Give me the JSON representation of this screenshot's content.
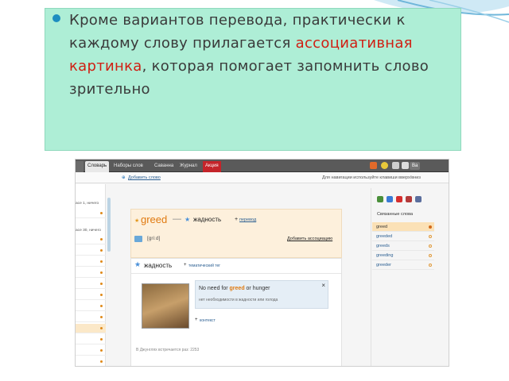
{
  "slide": {
    "bullet_part1": "Кроме вариантов перевода, практически к каждому слову прилагается",
    "bullet_highlight": "ассоциативная картинка",
    "bullet_part2": ", которая помогает запомнить слово зрительно",
    "highlight_color": "#d01e12",
    "box_color": "#aeeed6",
    "bullet_color": "#1d8dc0"
  },
  "app": {
    "tabs": [
      "Словарь",
      "Наборы слов",
      "Саванна",
      "Журнал",
      "Акция"
    ],
    "user_label": "Ва",
    "add_word": "Добавить слово",
    "hint_text": "Для навигации используйте клавиши вверх/вниз"
  },
  "left_list": {
    "heading1": "асе 1, ничего",
    "heading2": "асе 30, ничего"
  },
  "word_card": {
    "word": "greed",
    "dash": "—",
    "translation": "жадность",
    "add_translation": "перевод",
    "transcription": "[ɡriːd]",
    "add_association": "Добавить ассоциацию"
  },
  "tag_card": {
    "title": "жадность",
    "add_tag": "тематический тег",
    "example_pre": "No need for ",
    "example_word": "greed",
    "example_post": " or hunger",
    "example_translation": "нет необходимости в жадности или голода",
    "close": "×",
    "context": "контекст",
    "footer": "В Джунглях встречается раз: 2253"
  },
  "related": {
    "title": "Связанные слова",
    "items": [
      "greed",
      "greeded",
      "greeds",
      "greeding",
      "greeder"
    ]
  }
}
